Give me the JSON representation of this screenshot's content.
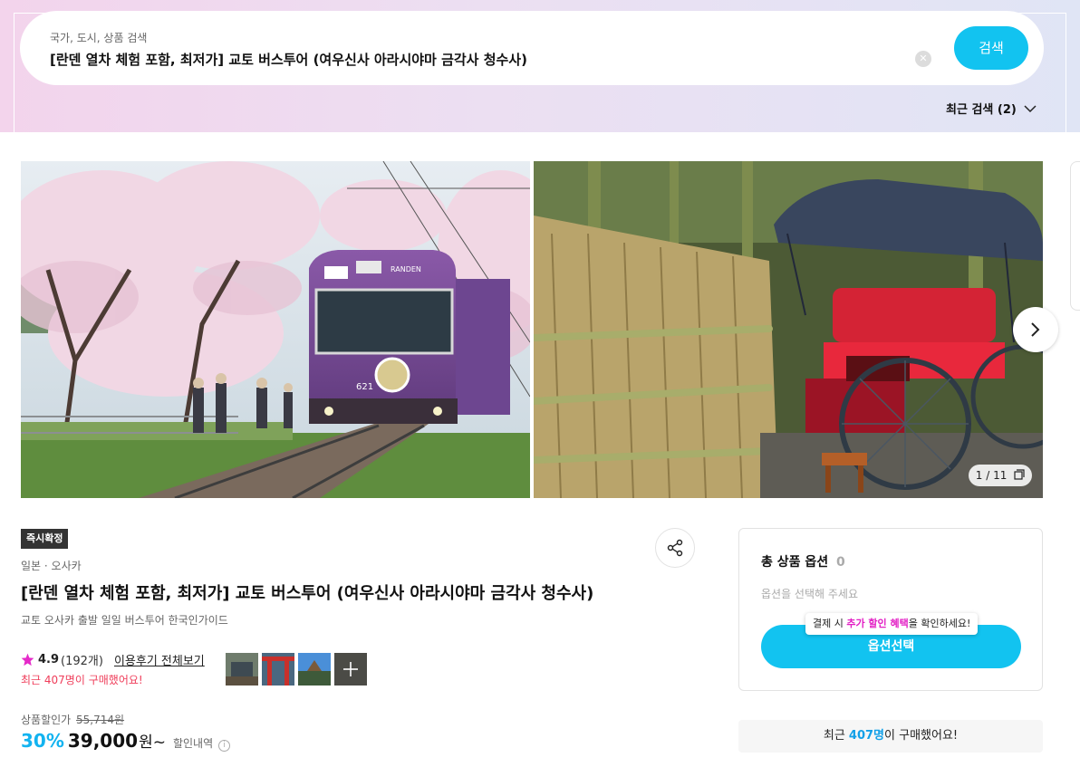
{
  "search": {
    "label": "국가, 도시, 상품 검색",
    "value": "[란덴 열차 체험 포함, 최저가] 교토 버스투어 (여우신사 아라시야마 금각사 청수사)",
    "button_label": "검색",
    "recent_label": "최근 검색 (2)"
  },
  "gallery": {
    "counter": "1 / 11",
    "train_sign": "RANDEN",
    "train_number": "621",
    "colors": {
      "train": "#7c4a9b",
      "blossom": "#f3dde8",
      "bamboo": "#c9b77c",
      "rickshaw": "#e8283c"
    }
  },
  "product": {
    "badge": "즉시확정",
    "location": "일본 · 오사카",
    "title": "[란덴 열차 체험 포함, 최저가] 교토 버스투어 (여우신사 아라시야마 금각사 청수사)",
    "subtitle": "교토 오사카 출발 일일 버스투어 한국인가이드",
    "rating": "4.9",
    "review_count": "(192개)",
    "all_reviews_label": "이용후기 전체보기",
    "recent_purchase": "최근 407명이 구매했어요!",
    "price_label": "상품할인가",
    "original_price": "55,714원",
    "discount_pct": "30%",
    "price": "39,000",
    "price_unit": "원~",
    "discount_detail": "할인내역"
  },
  "options": {
    "title": "총 상품 옵션",
    "count": "0",
    "placeholder": "옵션을 선택해 주세요",
    "tooltip_pre": "결제 시 ",
    "tooltip_highlight": "추가 할인 혜택",
    "tooltip_post": "을 확인하세요!",
    "button_label": "옵션선택"
  },
  "recent_bar": {
    "pre": "최근 ",
    "count": "407명",
    "post": "이 구매했어요!"
  },
  "accent": "#12c3f0"
}
